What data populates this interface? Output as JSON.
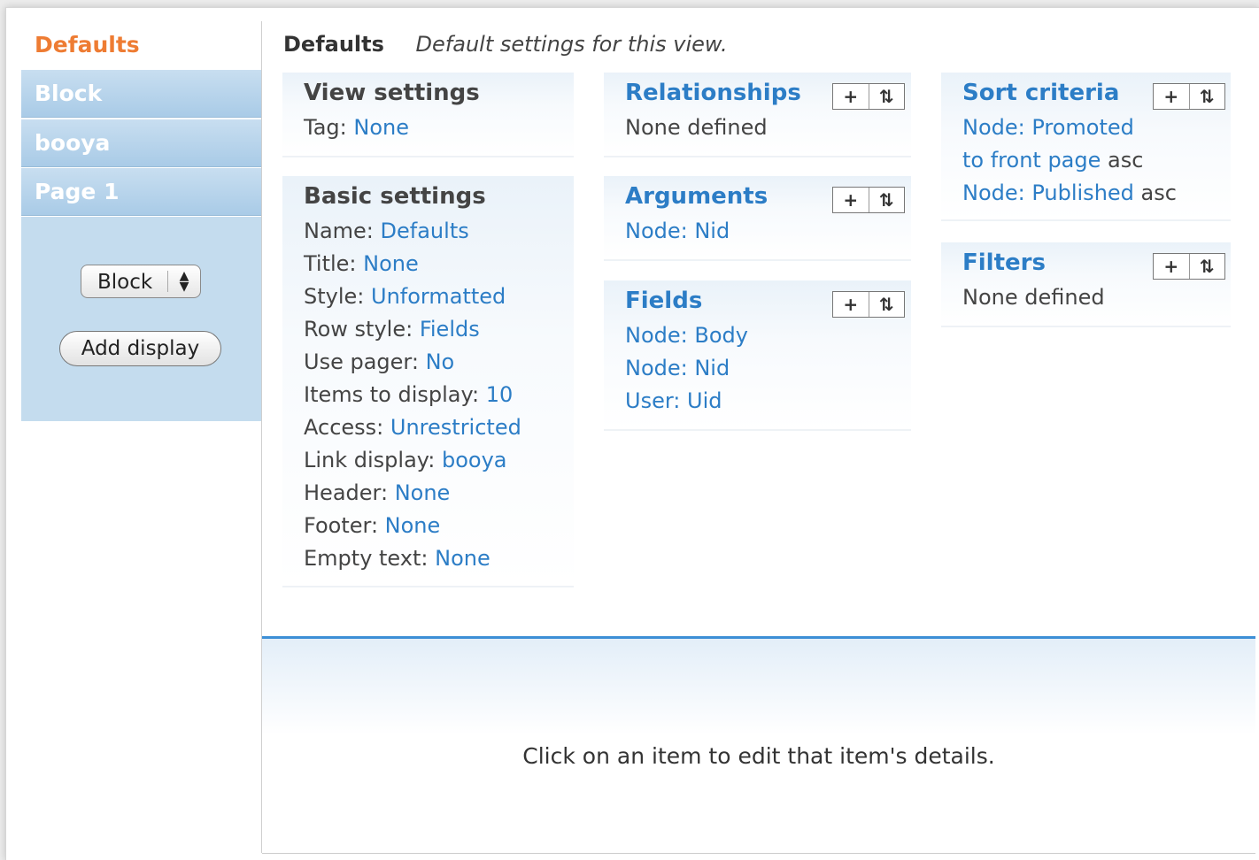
{
  "displays": {
    "tabs": [
      "Defaults",
      "Block",
      "booya",
      "Page 1"
    ],
    "select_value": "Block",
    "add_display": "Add display"
  },
  "header": {
    "title": "Defaults",
    "description": "Default settings for this view."
  },
  "view_settings": {
    "title": "View settings",
    "rows": [
      {
        "label": "Tag:",
        "value": "None"
      }
    ]
  },
  "basic_settings": {
    "title": "Basic settings",
    "rows": [
      {
        "label": "Name:",
        "value": "Defaults"
      },
      {
        "label": "Title:",
        "value": "None"
      },
      {
        "label": "Style:",
        "value": "Unformatted"
      },
      {
        "label": "Row style:",
        "value": "Fields"
      },
      {
        "label": "Use pager:",
        "value": "No"
      },
      {
        "label": "Items to display:",
        "value": "10"
      },
      {
        "label": "Access:",
        "value": "Unrestricted"
      },
      {
        "label": "Link display:",
        "value": "booya"
      },
      {
        "label": "Header:",
        "value": "None"
      },
      {
        "label": "Footer:",
        "value": "None"
      },
      {
        "label": "Empty text:",
        "value": "None"
      }
    ]
  },
  "relationships": {
    "title": "Relationships",
    "text": "None defined"
  },
  "arguments": {
    "title": "Arguments",
    "items": [
      "Node: Nid"
    ]
  },
  "fields": {
    "title": "Fields",
    "items": [
      "Node: Body",
      "Node: Nid",
      "User: Uid"
    ]
  },
  "sort_criteria": {
    "title": "Sort criteria",
    "items": [
      {
        "link": "Node: Promoted",
        "suffix": ""
      },
      {
        "link": "to front page",
        "suffix": " asc"
      },
      {
        "link": "Node: Published",
        "suffix": " asc"
      }
    ]
  },
  "filters": {
    "title": "Filters",
    "text": "None defined"
  },
  "tool_icons": {
    "add": "+",
    "rearrange": "⇅"
  },
  "bottom": {
    "message": "Click on an item to edit that item's details."
  },
  "colors": {
    "link": "#2c7dc6",
    "active_tab": "#ee7c33",
    "sidebar": "#c4dcee",
    "accent_border": "#3d8fd6"
  }
}
